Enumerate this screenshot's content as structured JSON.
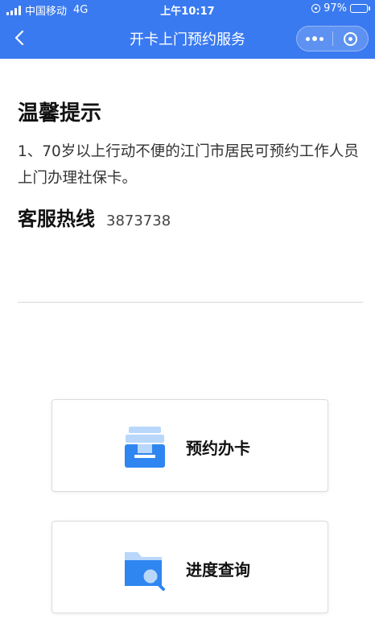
{
  "status_bar": {
    "carrier": "中国移动",
    "network": "4G",
    "time": "上午10:17",
    "battery_percent": "97%",
    "battery_level": 0.97
  },
  "nav": {
    "title": "开卡上门预约服务",
    "back_icon": "chevron-left-icon",
    "more_icon": "more-dots-icon",
    "close_icon": "target-ring-icon"
  },
  "notice": {
    "title": "温馨提示",
    "body": "1、70岁以上行动不便的江门市居民可预约工作人员上门办理社保卡。",
    "hotline_label": "客服热线",
    "hotline_number": "3873738"
  },
  "actions": [
    {
      "label": "预约办卡",
      "icon": "inbox-tray-icon"
    },
    {
      "label": "进度查询",
      "icon": "folder-search-icon"
    }
  ],
  "colors": {
    "primary": "#3a7af0",
    "icon_blue": "#2f86f0",
    "icon_light": "#b9d7fb"
  }
}
